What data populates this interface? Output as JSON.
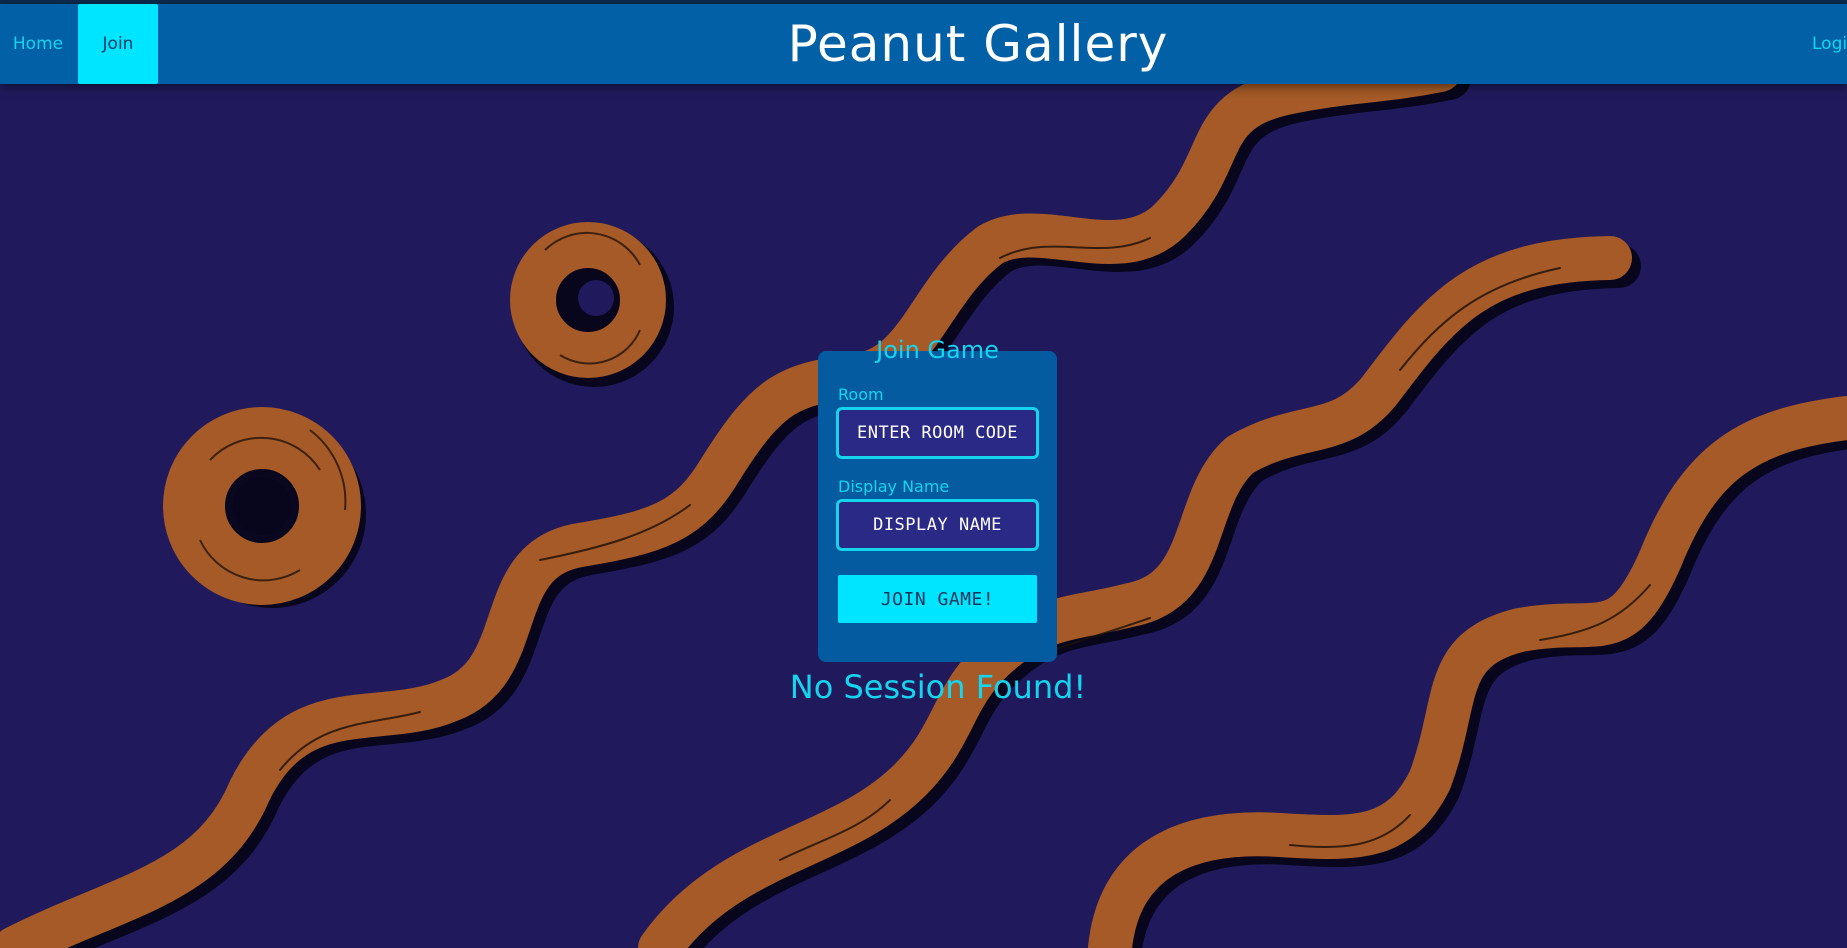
{
  "nav": {
    "home_label": "Home",
    "join_label": "Join",
    "login_label": "Login",
    "brand": "Peanut Gallery"
  },
  "join_form": {
    "title": "Join Game",
    "room_label": "Room",
    "room_placeholder": "ENTER ROOM CODE",
    "name_label": "Display Name",
    "name_placeholder": "DISPLAY NAME",
    "submit_label": "JOIN GAME!"
  },
  "status_message": "No Session Found!",
  "colors": {
    "background": "#201a5c",
    "navbar": "#0160a6",
    "accent": "#00e5ff",
    "peanut": "#a55a27"
  }
}
